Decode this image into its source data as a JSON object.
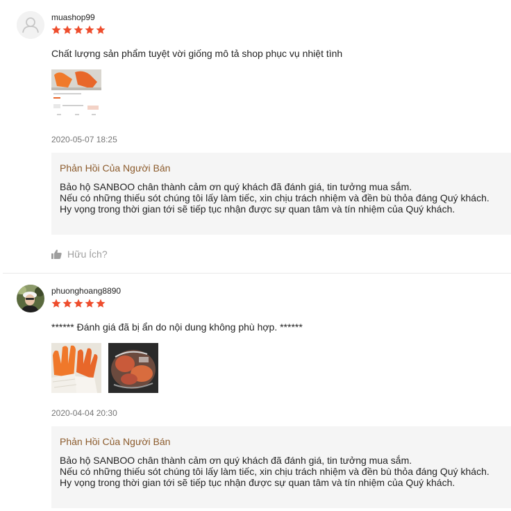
{
  "colors": {
    "star": "#ee4d2d",
    "reply_title": "#8b5a2b",
    "reply_bg": "#f5f5f5",
    "date": "#757575"
  },
  "reviews": [
    {
      "username": "muashop99",
      "rating": 5,
      "comment": "Chất lượng sản phẩm tuyệt vời giống mô tả shop phục vụ nhiệt tình",
      "date": "2020-05-07 18:25",
      "reply_title": "Phản Hồi Của Người Bán",
      "reply_text": "Bảo hộ SANBOO chân thành cảm ơn quý khách đã đánh giá, tin tưởng mua sắm.\nNếu có những thiếu sót chúng tôi lấy làm tiếc, xin chịu trách nhiệm và đền bù thỏa đáng Quý khách.\nHy vọng trong thời gian tới sẽ tiếp tục nhận được sự quan tâm và tín nhiệm của Quý khách.",
      "helpful_label": "Hữu Ích?",
      "avatar_icon": "default-user-icon"
    },
    {
      "username": "phuonghoang8890",
      "rating": 5,
      "comment": "****** Đánh giá đã bị ẩn do nội dung không phù hợp. ******",
      "date": "2020-04-04 20:30",
      "reply_title": "Phản Hồi Của Người Bán",
      "reply_text": "Bảo hộ SANBOO chân thành cảm ơn quý khách đã đánh giá, tin tưởng mua sắm.\nNếu có những thiếu sót chúng tôi lấy làm tiếc, xin chịu trách nhiệm và đền bù thỏa đáng Quý khách.\nHy vọng trong thời gian tới sẽ tiếp tục nhận được sự quan tâm và tín nhiệm của Quý khách.",
      "avatar_icon": "user-photo"
    }
  ]
}
